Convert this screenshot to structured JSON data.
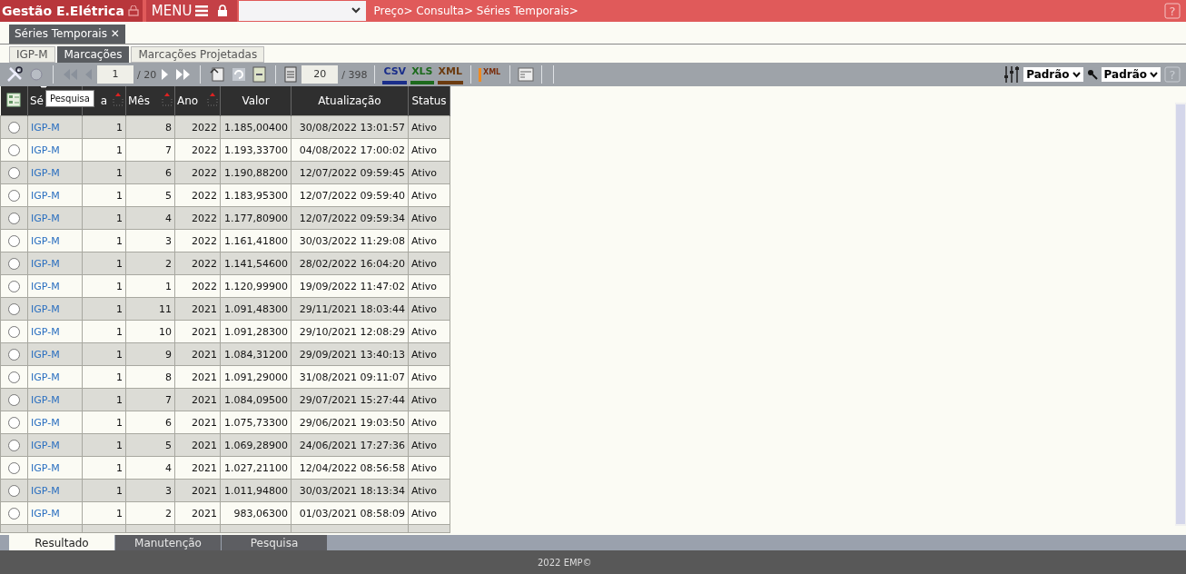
{
  "header": {
    "app_title": "Gestão E.Elétrica",
    "menu_label": "MENU",
    "breadcrumb": "Preço> Consulta> Séries Temporais>",
    "help": "?"
  },
  "page_tab": {
    "label": "Séries Temporais",
    "close": "✕"
  },
  "tabs": [
    {
      "label": "IGP-M",
      "selected": false
    },
    {
      "label": "Marcações",
      "selected": true
    },
    {
      "label": "Marcações Projetadas",
      "selected": false
    }
  ],
  "toolbar": {
    "page": "1",
    "page_total": "/ 20",
    "page_size": "20",
    "record_total": "/ 398",
    "export_csv": "CSV",
    "export_xls": "XLS",
    "export_xml": "XML",
    "import_xml": "XML",
    "layout_select": "Padrão",
    "filter_select": "Padrão",
    "help": "?"
  },
  "tooltip": "Pesquisa",
  "table": {
    "columns": [
      "Sé",
      "a",
      "Mês",
      "Ano",
      "Valor",
      "Atualização",
      "Status"
    ],
    "rows": [
      {
        "selected": false,
        "cells": [
          "IGP-M",
          "1",
          "8",
          "2022",
          "1.185,00400",
          "30/08/2022 13:01:57",
          "Ativo"
        ]
      },
      {
        "selected": false,
        "cells": [
          "IGP-M",
          "1",
          "7",
          "2022",
          "1.193,33700",
          "04/08/2022 17:00:02",
          "Ativo"
        ]
      },
      {
        "selected": false,
        "cells": [
          "IGP-M",
          "1",
          "6",
          "2022",
          "1.190,88200",
          "12/07/2022 09:59:45",
          "Ativo"
        ]
      },
      {
        "selected": false,
        "cells": [
          "IGP-M",
          "1",
          "5",
          "2022",
          "1.183,95300",
          "12/07/2022 09:59:40",
          "Ativo"
        ]
      },
      {
        "selected": false,
        "cells": [
          "IGP-M",
          "1",
          "4",
          "2022",
          "1.177,80900",
          "12/07/2022 09:59:34",
          "Ativo"
        ]
      },
      {
        "selected": false,
        "cells": [
          "IGP-M",
          "1",
          "3",
          "2022",
          "1.161,41800",
          "30/03/2022 11:29:08",
          "Ativo"
        ]
      },
      {
        "selected": false,
        "cells": [
          "IGP-M",
          "1",
          "2",
          "2022",
          "1.141,54600",
          "28/02/2022 16:04:20",
          "Ativo"
        ]
      },
      {
        "selected": false,
        "cells": [
          "IGP-M",
          "1",
          "1",
          "2022",
          "1.120,99900",
          "19/09/2022 11:47:02",
          "Ativo"
        ]
      },
      {
        "selected": false,
        "cells": [
          "IGP-M",
          "1",
          "11",
          "2021",
          "1.091,48300",
          "29/11/2021 18:03:44",
          "Ativo"
        ]
      },
      {
        "selected": false,
        "cells": [
          "IGP-M",
          "1",
          "10",
          "2021",
          "1.091,28300",
          "29/10/2021 12:08:29",
          "Ativo"
        ]
      },
      {
        "selected": false,
        "cells": [
          "IGP-M",
          "1",
          "9",
          "2021",
          "1.084,31200",
          "29/09/2021 13:40:13",
          "Ativo"
        ]
      },
      {
        "selected": false,
        "cells": [
          "IGP-M",
          "1",
          "8",
          "2021",
          "1.091,29000",
          "31/08/2021 09:11:07",
          "Ativo"
        ]
      },
      {
        "selected": false,
        "cells": [
          "IGP-M",
          "1",
          "7",
          "2021",
          "1.084,09500",
          "29/07/2021 15:27:44",
          "Ativo"
        ]
      },
      {
        "selected": false,
        "cells": [
          "IGP-M",
          "1",
          "6",
          "2021",
          "1.075,73300",
          "29/06/2021 19:03:50",
          "Ativo"
        ]
      },
      {
        "selected": false,
        "cells": [
          "IGP-M",
          "1",
          "5",
          "2021",
          "1.069,28900",
          "24/06/2021 17:27:36",
          "Ativo"
        ]
      },
      {
        "selected": false,
        "cells": [
          "IGP-M",
          "1",
          "4",
          "2021",
          "1.027,21100",
          "12/04/2022 08:56:58",
          "Ativo"
        ]
      },
      {
        "selected": false,
        "cells": [
          "IGP-M",
          "1",
          "3",
          "2021",
          "1.011,94800",
          "30/03/2021 18:13:34",
          "Ativo"
        ]
      },
      {
        "selected": false,
        "cells": [
          "IGP-M",
          "1",
          "2",
          "2021",
          "983,06300",
          "01/03/2021 08:58:09",
          "Ativo"
        ]
      }
    ]
  },
  "bottom_tabs": [
    {
      "label": "Resultado",
      "selected": true
    },
    {
      "label": "Manutenção",
      "selected": false
    },
    {
      "label": "Pesquisa",
      "selected": false
    }
  ],
  "footer": "2022 EMP©"
}
